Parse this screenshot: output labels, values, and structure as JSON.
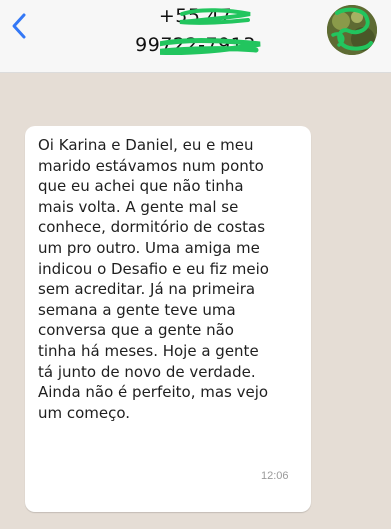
{
  "header": {
    "back_icon": "chevron-left-icon",
    "contact_line_1": "+55 47",
    "contact_line_2": "99722-7913",
    "avatar_icon": "contact-avatar"
  },
  "colors": {
    "accent": "#3478f6",
    "header_bg": "#f7f7f7",
    "chat_bg": "#e5ddd5",
    "bubble_bg": "#ffffff",
    "redaction": "#22c55e"
  },
  "message": {
    "lines": [
      "Oi Karina e Daniel, eu e meu",
      "marido estávamos num ponto",
      "que eu achei que não tinha",
      "mais volta. A gente mal se",
      "conhece, dormitório de costas",
      "um pro outro. Uma amiga me",
      "indicou o Desafio e eu fiz meio",
      "sem acreditar. Já na primeira",
      "semana a gente teve uma",
      "conversa que a gente não",
      "tinha há meses. Hoje a gente",
      "tá junto de novo de verdade.",
      "Ainda não é perfeito, mas vejo",
      "um começo."
    ],
    "time": "12:06"
  }
}
